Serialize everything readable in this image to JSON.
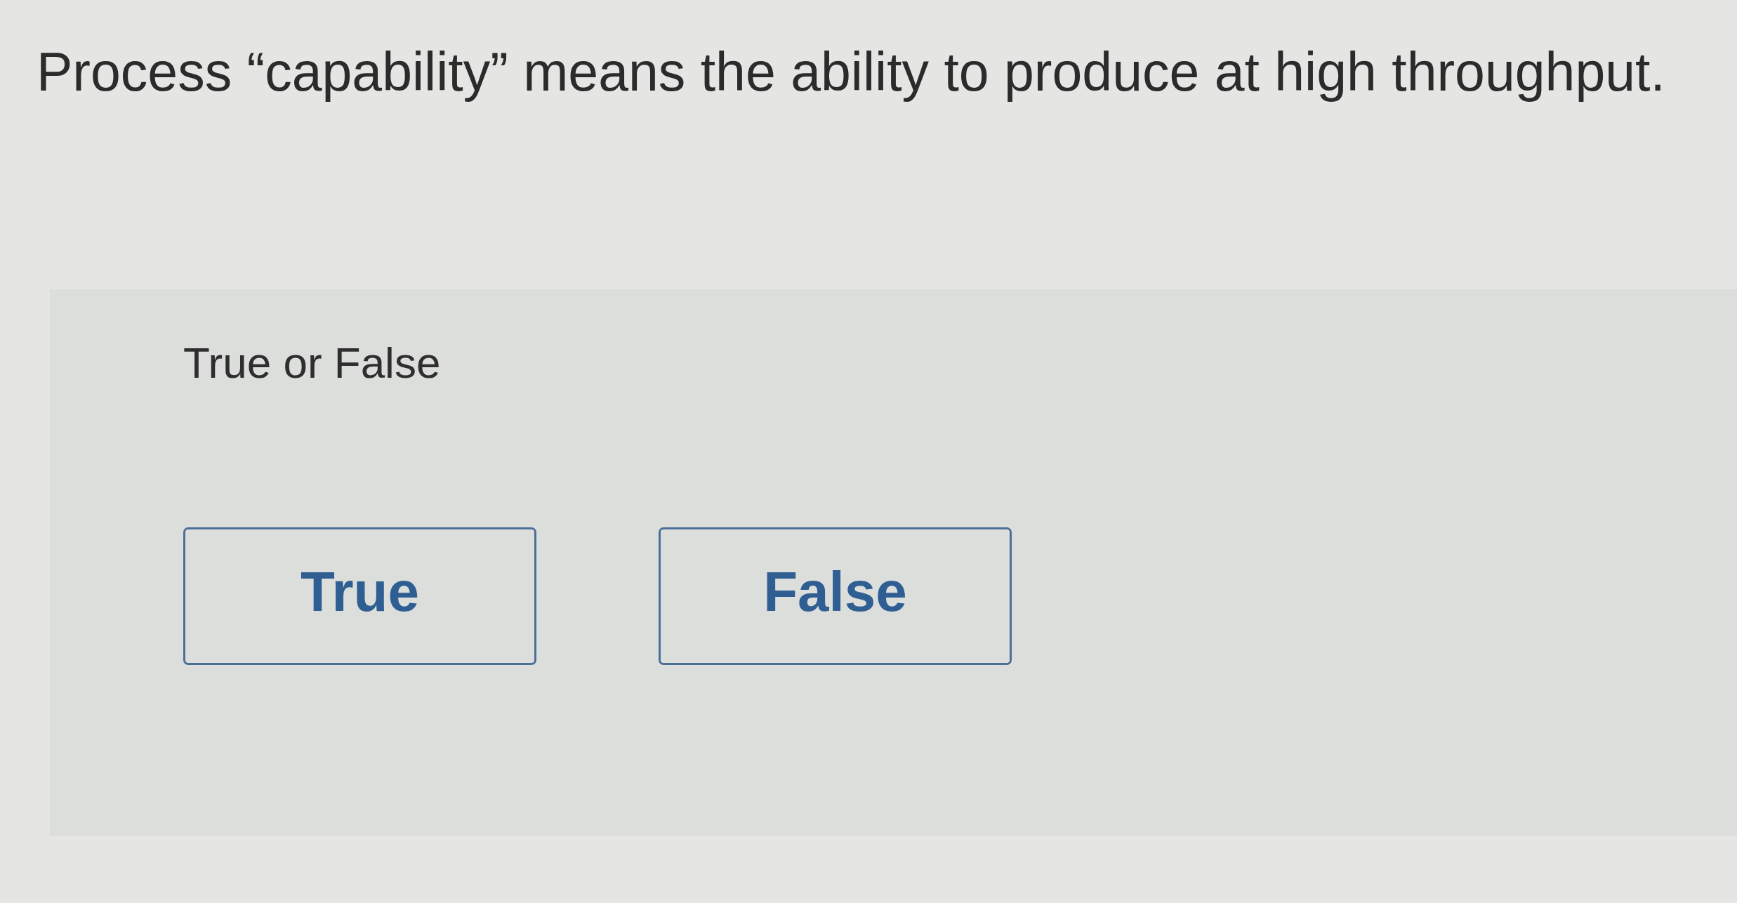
{
  "question": "Process “capability” means the ability to produce at high throughput.",
  "panel": {
    "prompt": "True or False",
    "options": [
      {
        "label": "True",
        "selected": false
      },
      {
        "label": "False",
        "selected": false
      }
    ]
  }
}
